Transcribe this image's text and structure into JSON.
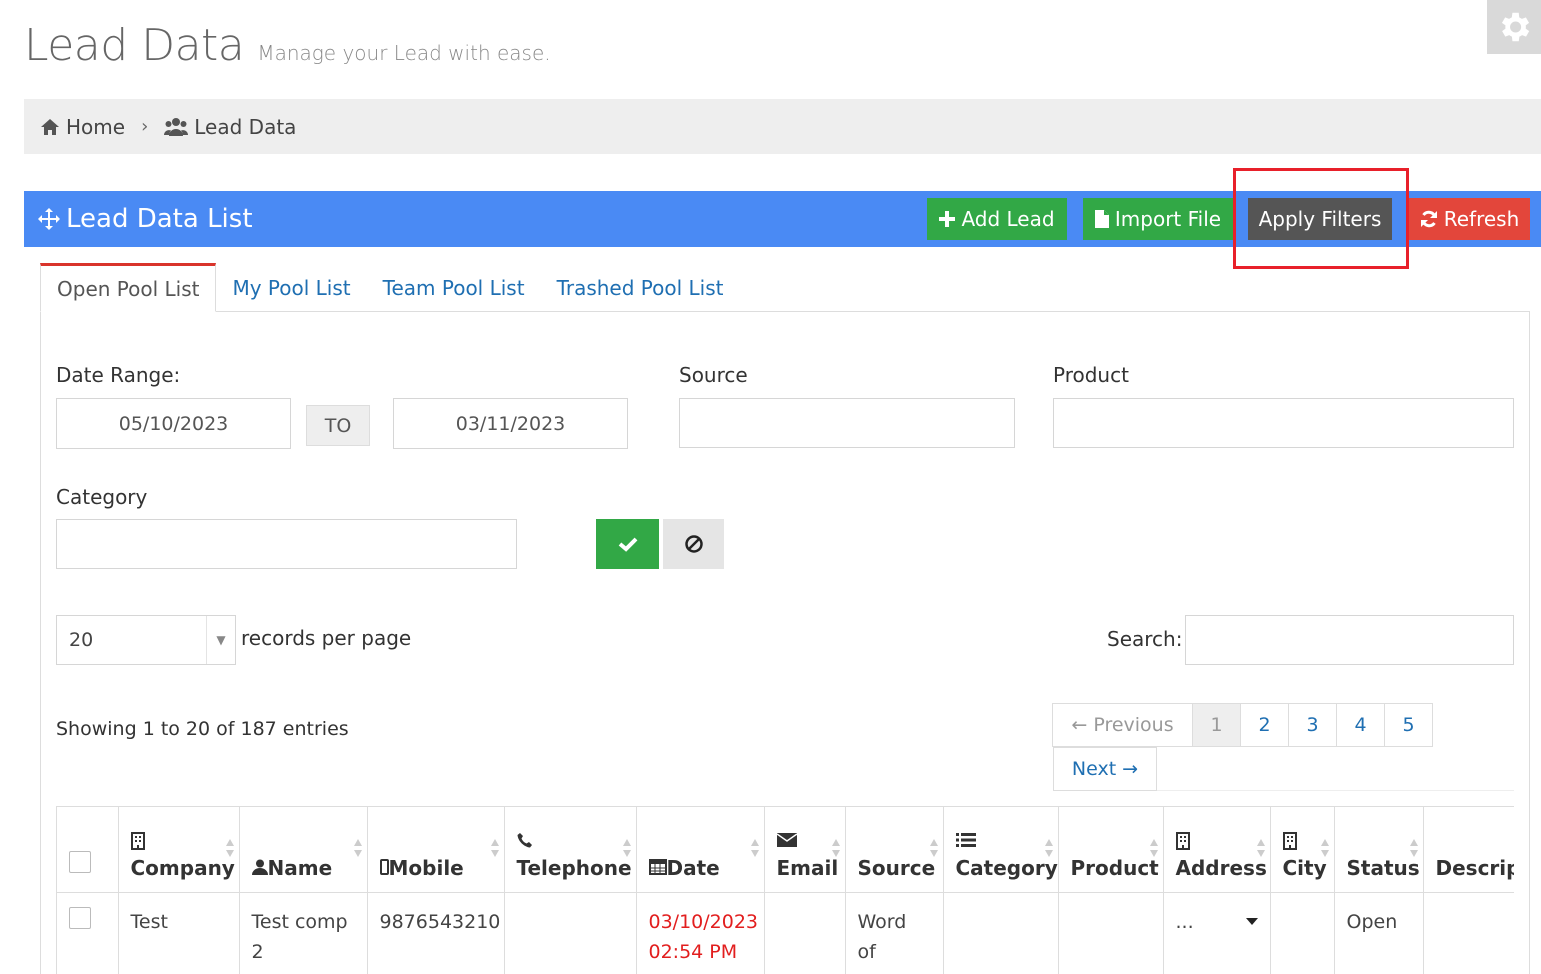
{
  "header": {
    "title": "Lead Data",
    "subtitle": "Manage your Lead with ease.",
    "settings_icon": "gear-icon"
  },
  "breadcrumb": {
    "home": "Home",
    "current": "Lead Data"
  },
  "portlet": {
    "title": "Lead Data List",
    "buttons": {
      "add": "Add Lead",
      "import": "Import File",
      "apply": "Apply Filters",
      "refresh": "Refresh"
    },
    "colors": {
      "header": "#4a8af4",
      "green": "#32a846",
      "red": "#e3463b",
      "dark": "#555555",
      "highlight": "#e8202a"
    }
  },
  "tabs": [
    "Open Pool List",
    "My Pool List",
    "Team Pool List",
    "Trashed Pool List"
  ],
  "filters": {
    "date_range_label": "Date Range:",
    "date_from": "05/10/2023",
    "to_label": "TO",
    "date_to": "03/11/2023",
    "source_label": "Source",
    "source_value": "",
    "product_label": "Product",
    "product_value": "",
    "category_label": "Category",
    "category_value": ""
  },
  "list_controls": {
    "per_page_value": "20",
    "per_page_label": "records per page",
    "search_label": "Search:",
    "search_value": "",
    "info": "Showing 1 to 20 of 187 entries"
  },
  "pagination": {
    "previous": "← Previous",
    "pages": [
      "1",
      "2",
      "3",
      "4",
      "5"
    ],
    "current": "1",
    "next": "Next →"
  },
  "table": {
    "columns": [
      "Company",
      "Name",
      "Mobile",
      "Telephone",
      "Date",
      "Email",
      "Source",
      "Category",
      "Product",
      "Address",
      "City",
      "Status",
      "Descripti"
    ],
    "rows": [
      {
        "company": "Test",
        "name": "Test comp 2",
        "mobile": "9876543210",
        "telephone": "",
        "date": "03/10/2023 02:54 PM",
        "email": "",
        "source": "Word of mouth",
        "category": "",
        "product": "",
        "address": "...",
        "city": "",
        "status": "Open",
        "description": ""
      }
    ]
  }
}
